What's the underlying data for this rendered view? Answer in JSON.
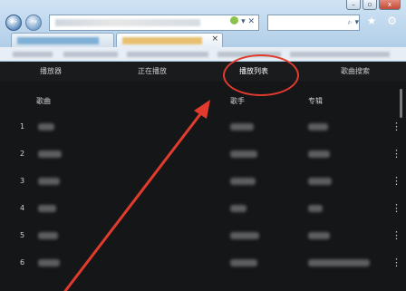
{
  "browser": {
    "nav_back_glyph": "←",
    "nav_forward_glyph": "→",
    "address_icons": "▾ ✕",
    "search_glyph": "⌕ ▾",
    "tool_icons": "⌂ ★ ⚙",
    "tab_close": "×",
    "window_buttons": [
      "–",
      "▫",
      "x"
    ]
  },
  "app_nav": {
    "items": [
      {
        "label": "播放器"
      },
      {
        "label": "正在播放"
      },
      {
        "label": "播放列表"
      },
      {
        "label": "歌曲搜索"
      }
    ],
    "active_index": 2
  },
  "table": {
    "columns": {
      "song": "歌曲",
      "artist": "歌手",
      "album": "专辑"
    },
    "rows": [
      {
        "num": "1"
      },
      {
        "num": "2"
      },
      {
        "num": "3"
      },
      {
        "num": "4"
      },
      {
        "num": "5"
      },
      {
        "num": "6"
      }
    ],
    "more_glyph": "⋮"
  },
  "colors": {
    "annotation": "#e23b2e",
    "background": "#151618"
  }
}
